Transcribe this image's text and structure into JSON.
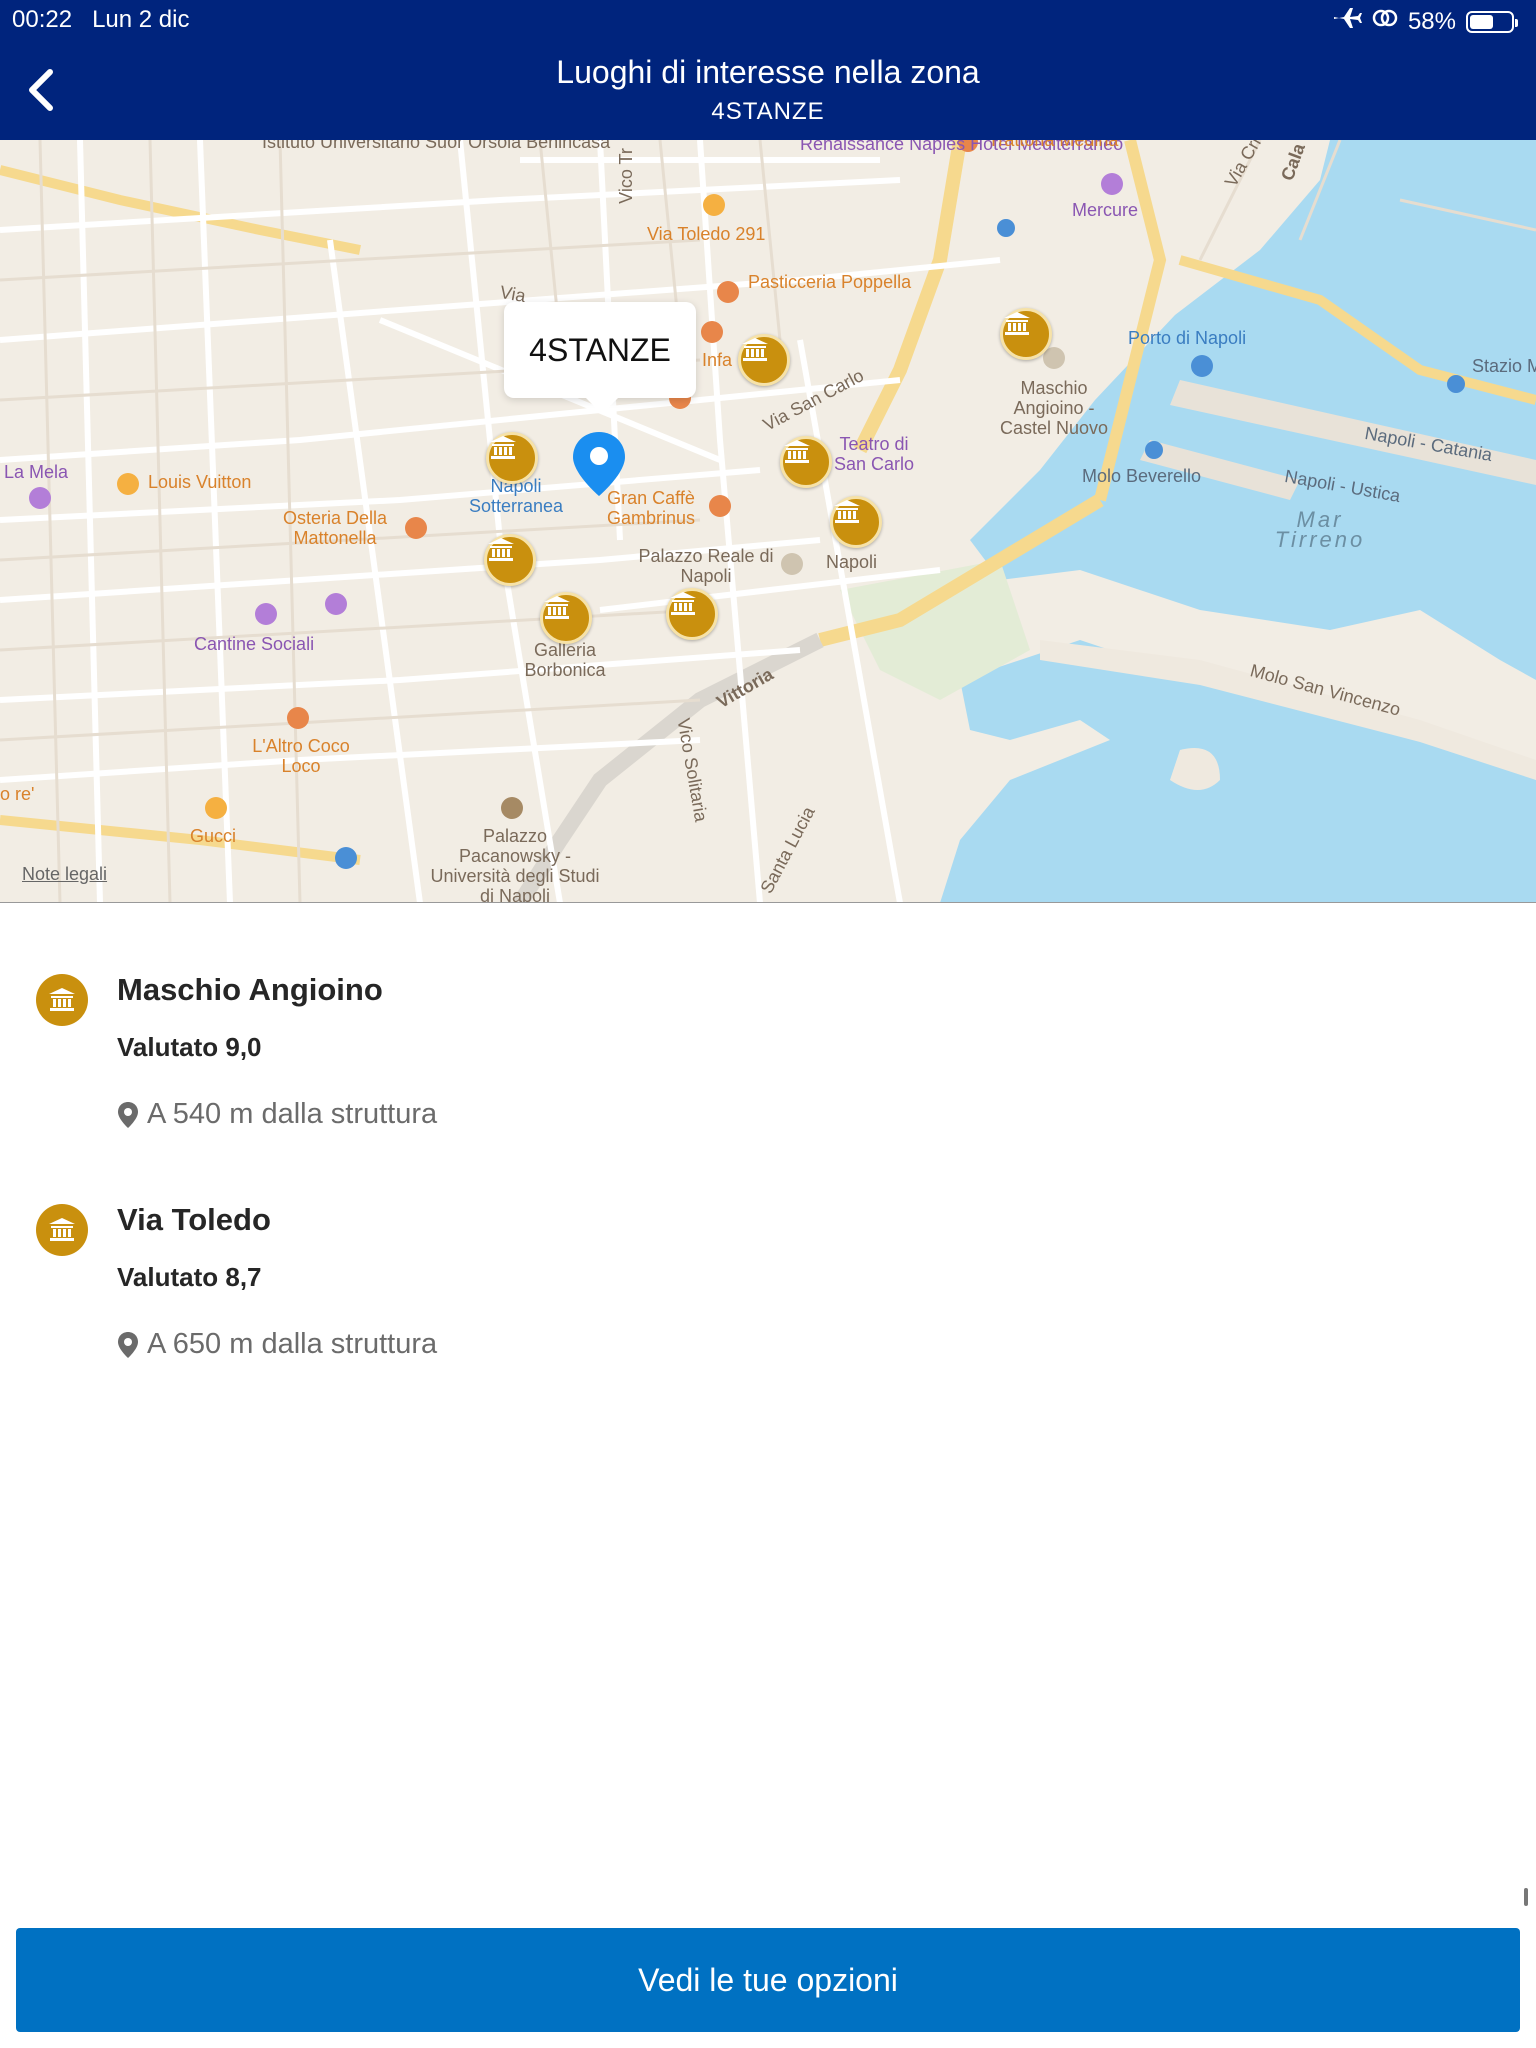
{
  "status_bar": {
    "time": "00:22",
    "date": "Lun 2 dic",
    "battery": "58%",
    "battery_level": 0.58
  },
  "header": {
    "title": "Luoghi di interesse nella zona",
    "subtitle": "4STANZE"
  },
  "map": {
    "callout": "4STANZE",
    "legal": "Note legali",
    "labels": {
      "universitario": "Istituto Universitario Suor Orsola Benincasa",
      "renaissance": "Renaissance Naples Hotel Mediterraneo",
      "trattoria": "Trattoria Medina",
      "mercure": "Mercure",
      "via_toledo": "Via Toledo 291",
      "pasticceria": "Pasticceria Poppella",
      "infa": "Infa",
      "via_san_carlo": "Via San Carlo",
      "via_cristoforo": "Via Cri",
      "cala": "Cala",
      "porto": "Porto di Napoli",
      "stazione": "Stazio Maritt Termi",
      "maschio_map": "Maschio Angioino - Castel Nuovo",
      "la_mela": "La Mela",
      "louis_vuitton": "Louis Vuitton",
      "napoli_sotterranea": "Napoli Sotterranea",
      "gran_caffe": "Gran Caffè Gambrinus",
      "teatro": "Teatro di San Carlo",
      "molo_beverello": "Molo Beverello",
      "napoli_catania": "Napoli - Catania",
      "napoli_ustica": "Napoli - Ustica",
      "mar_tirreno": "Mar Tirreno",
      "osteria": "Osteria Della Mattonella",
      "palazzo_reale": "Palazzo Reale di Napoli",
      "napoli": "Napoli",
      "cantine": "Cantine Sociali",
      "galleria": "Galleria Borbonica",
      "vittoria": "Vittoria",
      "vico_solitaria": "Vico Solitaria",
      "molo_san_vincenzo": "Molo San Vincenzo",
      "altro_coco": "L'Altro Coco Loco",
      "ore": "o re'",
      "gucci": "Gucci",
      "palazzo_pacanowsky": "Palazzo Pacanowsky - Università degli Studi di Napoli",
      "santa_lucia": "Santa Lucia",
      "vico_tr": "Vico Tr",
      "via": "Via"
    }
  },
  "places": [
    {
      "name": "Maschio Angioino",
      "rating": "Valutato 9,0",
      "distance": "A 540 m dalla struttura"
    },
    {
      "name": "Via Toledo",
      "rating": "Valutato 8,7",
      "distance": "A 650 m dalla struttura"
    }
  ],
  "cta_label": "Vedi le tue opzioni",
  "colors": {
    "header": "#00247d",
    "cta": "#0071c2",
    "poi": "#c9900e",
    "sea": "#a9daf1",
    "pin": "#1a8ef0"
  },
  "icons": {
    "back": "chevron-left-icon",
    "poi": "museum-icon",
    "location": "map-pin-icon",
    "airplane": "airplane-icon",
    "battery": "battery-icon"
  }
}
